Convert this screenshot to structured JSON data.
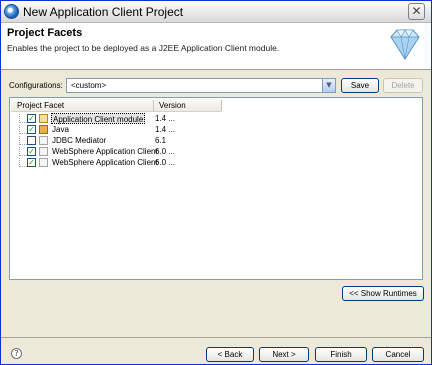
{
  "window": {
    "title": "New Application Client Project",
    "close_glyph": "✕"
  },
  "banner": {
    "title": "Project Facets",
    "description": "Enables the project to be deployed as a J2EE Application Client module."
  },
  "configurations": {
    "label": "Configurations:",
    "value": "<custom>",
    "save_label": "Save",
    "delete_label": "Delete"
  },
  "facets_table": {
    "columns": [
      "Project Facet",
      "Version"
    ],
    "rows": [
      {
        "name": "Application Client module",
        "version": "1.4 ...",
        "checked": true,
        "selected": true
      },
      {
        "name": "Java",
        "version": "1.4 ...",
        "checked": true,
        "selected": false
      },
      {
        "name": "JDBC Mediator",
        "version": "6.1",
        "checked": false,
        "selected": false
      },
      {
        "name": "WebSphere Application Client",
        "version": "6.0 ...",
        "checked": true,
        "selected": false
      },
      {
        "name": "WebSphere Application Client",
        "version": "6.0 ...",
        "checked": true,
        "selected": false
      }
    ],
    "show_runtimes_label": "<< Show Runtimes"
  },
  "footer": {
    "help_glyph": "?",
    "back_label": "< Back",
    "next_label": "Next >",
    "finish_label": "Finish",
    "cancel_label": "Cancel"
  },
  "colors": {
    "window_border": "#0831d9",
    "dialog_background": "#ece9d8",
    "check_mark": "#21a121",
    "button_border": "#003c74"
  }
}
